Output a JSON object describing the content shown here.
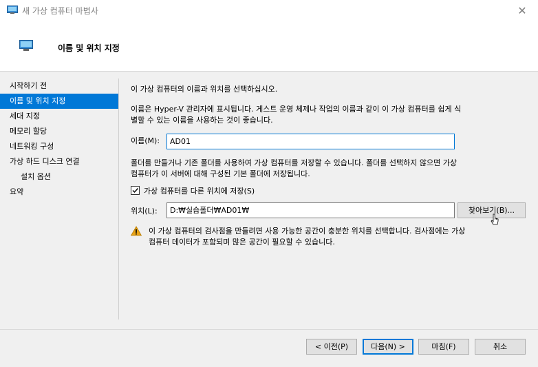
{
  "window": {
    "title": "새 가상 컴퓨터 마법사",
    "close_glyph": "✕"
  },
  "header": {
    "title": "이름 및 위치 지정"
  },
  "nav": {
    "items": [
      {
        "label": "시작하기 전"
      },
      {
        "label": "이름 및 위치 지정",
        "selected": true
      },
      {
        "label": "세대 지정"
      },
      {
        "label": "메모리 할당"
      },
      {
        "label": "네트워킹 구성"
      },
      {
        "label": "가상 하드 디스크 연결"
      },
      {
        "label": "설치 옵션",
        "sub": true
      },
      {
        "label": "요약"
      }
    ]
  },
  "main": {
    "intro": "이 가상 컴퓨터의 이름과 위치를 선택하십시오.",
    "name_desc_line1": "이름은 Hyper-V 관리자에 표시됩니다. 게스트 운영 체제나 작업의 이름과 같이 이 가상 컴퓨터를 쉽게 식",
    "name_desc_line2": "별할 수 있는 이름을 사용하는 것이 좋습니다.",
    "name_label": "이름(M):",
    "name_value": "AD01",
    "folder_desc_line1": "폴더를 만들거나 기존 폴더를 사용하여 가상 컴퓨터를 저장할 수 있습니다. 폴더를 선택하지 않으면 가상",
    "folder_desc_line2": "컴퓨터가 이 서버에 대해 구성된 기본 폴더에 저장됩니다.",
    "store_checkbox_label": "가상 컴퓨터를 다른 위치에 저장(S)",
    "store_checked": true,
    "location_label": "위치(L):",
    "location_value": "D:₩실습폴더₩AD01₩",
    "browse_label": "찾아보기(B)...",
    "warning_line1": "이 가상 컴퓨터의 검사점을 만들려면 사용 가능한 공간이 충분한 위치를 선택합니다. 검사점에는 가상",
    "warning_line2": "컴퓨터 데이터가 포함되며 많은 공간이 필요할 수 있습니다."
  },
  "footer": {
    "prev_label": "< 이전(P)",
    "next_label": "다음(N) >",
    "finish_label": "마침(F)",
    "cancel_label": "취소"
  },
  "colors": {
    "accent": "#0078d7",
    "warning": "#e8a317"
  }
}
